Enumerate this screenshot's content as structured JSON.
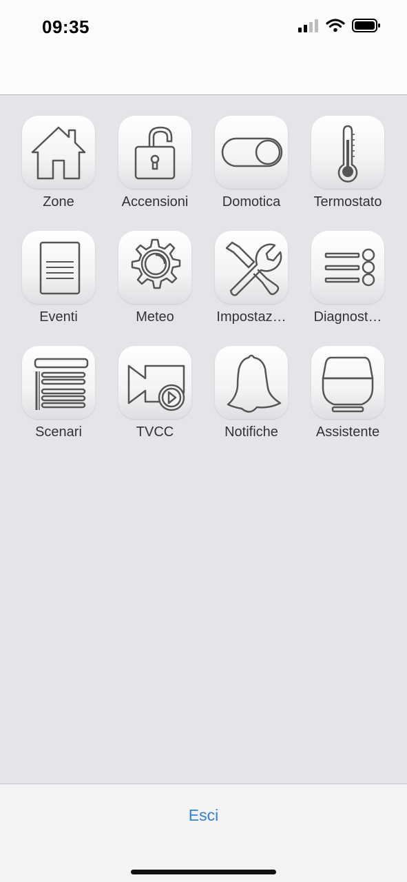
{
  "status_bar": {
    "time": "09:35",
    "icons": [
      "signal-icon",
      "wifi-icon",
      "battery-icon"
    ]
  },
  "menu": {
    "tiles": [
      {
        "label": "Zone",
        "icon": "home-icon"
      },
      {
        "label": "Accensioni",
        "icon": "unlocked-padlock-icon"
      },
      {
        "label": "Domotica",
        "icon": "toggle-switch-icon"
      },
      {
        "label": "Termostato",
        "icon": "thermometer-icon"
      },
      {
        "label": "Eventi",
        "icon": "document-icon"
      },
      {
        "label": "Meteo",
        "icon": "weather-gear-icon"
      },
      {
        "label": "Impostaz…",
        "icon": "tools-icon"
      },
      {
        "label": "Diagnost…",
        "icon": "list-settings-icon"
      },
      {
        "label": "Scenari",
        "icon": "blinds-icon"
      },
      {
        "label": "TVCC",
        "icon": "video-camera-icon"
      },
      {
        "label": "Notifiche",
        "icon": "bell-icon"
      },
      {
        "label": "Assistente",
        "icon": "smart-speaker-icon"
      }
    ]
  },
  "footer": {
    "exit_label": "Esci"
  },
  "colors": {
    "background": "#e4e4e9",
    "link": "#2f80d8",
    "icon_stroke": "#555555"
  }
}
